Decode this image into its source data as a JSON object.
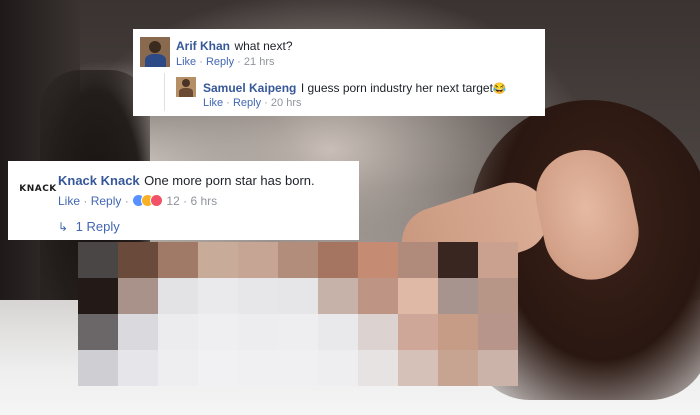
{
  "comments": {
    "arif": {
      "name": "Arif Khan",
      "text": "what next?",
      "like": "Like",
      "reply": "Reply",
      "time": "21 hrs"
    },
    "samuel": {
      "name": "Samuel Kaipeng",
      "text": "I guess porn industry her next target",
      "emoji": "😂",
      "like": "Like",
      "reply": "Reply",
      "time": "20 hrs"
    },
    "knack": {
      "name": "Knack Knack",
      "text": "One more porn star has born.",
      "like": "Like",
      "reply": "Reply",
      "reaction_count": "12",
      "time": "6 hrs",
      "replies_link": "1 Reply",
      "logo_text": "KNACK"
    }
  },
  "icons": {
    "reply_arrow": "↳",
    "reactions": [
      "like-icon",
      "haha-icon",
      "love-icon"
    ]
  },
  "colors": {
    "name_blue": "#365899",
    "link_blue": "#4267b2",
    "meta_gray": "#90949c"
  }
}
